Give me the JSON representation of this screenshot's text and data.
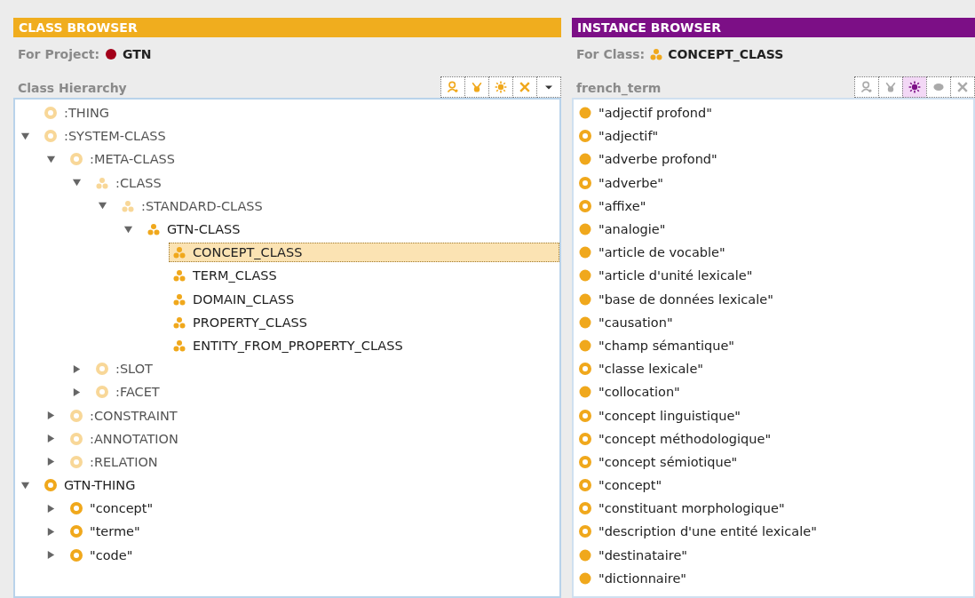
{
  "class_browser": {
    "title": "CLASS BROWSER",
    "for_label": "For Project:",
    "project": "GTN",
    "hierarchy_label": "Class Hierarchy",
    "toolbar": [
      {
        "kind": "person",
        "selected": false,
        "disabled": false
      },
      {
        "kind": "branch",
        "selected": false,
        "disabled": false
      },
      {
        "kind": "star",
        "selected": false,
        "disabled": false
      },
      {
        "kind": "cross",
        "selected": false,
        "disabled": false
      },
      {
        "kind": "dropdown",
        "selected": false,
        "disabled": false
      }
    ],
    "tree": [
      {
        "label": ":THING",
        "kind": "ring",
        "faded": true,
        "selected": false
      },
      {
        "label": ":SYSTEM-CLASS",
        "kind": "ring",
        "faded": true,
        "expanded": true,
        "selected": false,
        "children": [
          {
            "label": ":META-CLASS",
            "kind": "ring",
            "faded": true,
            "expanded": true,
            "selected": false,
            "children": [
              {
                "label": ":CLASS",
                "kind": "cluster",
                "faded": true,
                "expanded": true,
                "selected": false,
                "children": [
                  {
                    "label": ":STANDARD-CLASS",
                    "kind": "cluster",
                    "faded": true,
                    "expanded": true,
                    "selected": false,
                    "children": [
                      {
                        "label": "GTN-CLASS",
                        "kind": "cluster",
                        "faded": false,
                        "expanded": true,
                        "selected": false,
                        "children": [
                          {
                            "label": "CONCEPT_CLASS",
                            "kind": "cluster",
                            "faded": false,
                            "selected": true
                          },
                          {
                            "label": "TERM_CLASS",
                            "kind": "cluster",
                            "faded": false,
                            "selected": false
                          },
                          {
                            "label": "DOMAIN_CLASS",
                            "kind": "cluster",
                            "faded": false,
                            "selected": false
                          },
                          {
                            "label": "PROPERTY_CLASS",
                            "kind": "cluster",
                            "faded": false,
                            "selected": false
                          },
                          {
                            "label": "ENTITY_FROM_PROPERTY_CLASS",
                            "kind": "cluster",
                            "faded": false,
                            "selected": false
                          }
                        ]
                      }
                    ]
                  }
                ]
              },
              {
                "label": ":SLOT",
                "kind": "ring",
                "faded": true,
                "expanded": false,
                "selected": false
              },
              {
                "label": ":FACET",
                "kind": "ring",
                "faded": true,
                "expanded": false,
                "selected": false
              }
            ]
          },
          {
            "label": ":CONSTRAINT",
            "kind": "ring",
            "faded": true,
            "expanded": false,
            "selected": false
          },
          {
            "label": ":ANNOTATION",
            "kind": "ring",
            "faded": true,
            "expanded": false,
            "selected": false
          },
          {
            "label": ":RELATION",
            "kind": "ring",
            "faded": true,
            "expanded": false,
            "selected": false
          }
        ]
      },
      {
        "label": "GTN-THING",
        "kind": "ring",
        "faded": false,
        "expanded": true,
        "selected": false,
        "children": [
          {
            "label": "\"concept\"",
            "kind": "ring",
            "faded": false,
            "expanded": false,
            "selected": false
          },
          {
            "label": "\"terme\"",
            "kind": "ring",
            "faded": false,
            "expanded": false,
            "selected": false
          },
          {
            "label": "\"code\"",
            "kind": "ring",
            "faded": false,
            "expanded": false,
            "selected": false
          }
        ]
      }
    ]
  },
  "instance_browser": {
    "title": "INSTANCE BROWSER",
    "for_label": "For Class:",
    "class_name": "CONCEPT_CLASS",
    "slot_label": "french_term",
    "toolbar": [
      {
        "kind": "person",
        "selected": false,
        "disabled": true
      },
      {
        "kind": "branch",
        "selected": false,
        "disabled": true
      },
      {
        "kind": "star",
        "selected": true,
        "disabled": false
      },
      {
        "kind": "blob",
        "selected": false,
        "disabled": true
      },
      {
        "kind": "cross",
        "selected": false,
        "disabled": true
      }
    ],
    "instances": [
      {
        "label": "\"adjectif profond\"",
        "kind": "filled"
      },
      {
        "label": "\"adjectif\"",
        "kind": "ring"
      },
      {
        "label": "\"adverbe profond\"",
        "kind": "filled"
      },
      {
        "label": "\"adverbe\"",
        "kind": "ring"
      },
      {
        "label": "\"affixe\"",
        "kind": "ring"
      },
      {
        "label": "\"analogie\"",
        "kind": "filled"
      },
      {
        "label": "\"article de vocable\"",
        "kind": "filled"
      },
      {
        "label": "\"article d'unité lexicale\"",
        "kind": "filled"
      },
      {
        "label": "\"base de données lexicale\"",
        "kind": "filled"
      },
      {
        "label": "\"causation\"",
        "kind": "filled"
      },
      {
        "label": "\"champ sémantique\"",
        "kind": "filled"
      },
      {
        "label": "\"classe lexicale\"",
        "kind": "ring"
      },
      {
        "label": "\"collocation\"",
        "kind": "filled"
      },
      {
        "label": "\"concept linguistique\"",
        "kind": "ring"
      },
      {
        "label": "\"concept méthodologique\"",
        "kind": "ring"
      },
      {
        "label": "\"concept sémiotique\"",
        "kind": "ring"
      },
      {
        "label": "\"concept\"",
        "kind": "ring"
      },
      {
        "label": "\"constituant morphologique\"",
        "kind": "ring"
      },
      {
        "label": "\"description d'une entité lexicale\"",
        "kind": "ring"
      },
      {
        "label": "\"destinataire\"",
        "kind": "filled"
      },
      {
        "label": "\"dictionnaire\"",
        "kind": "filled"
      }
    ]
  }
}
